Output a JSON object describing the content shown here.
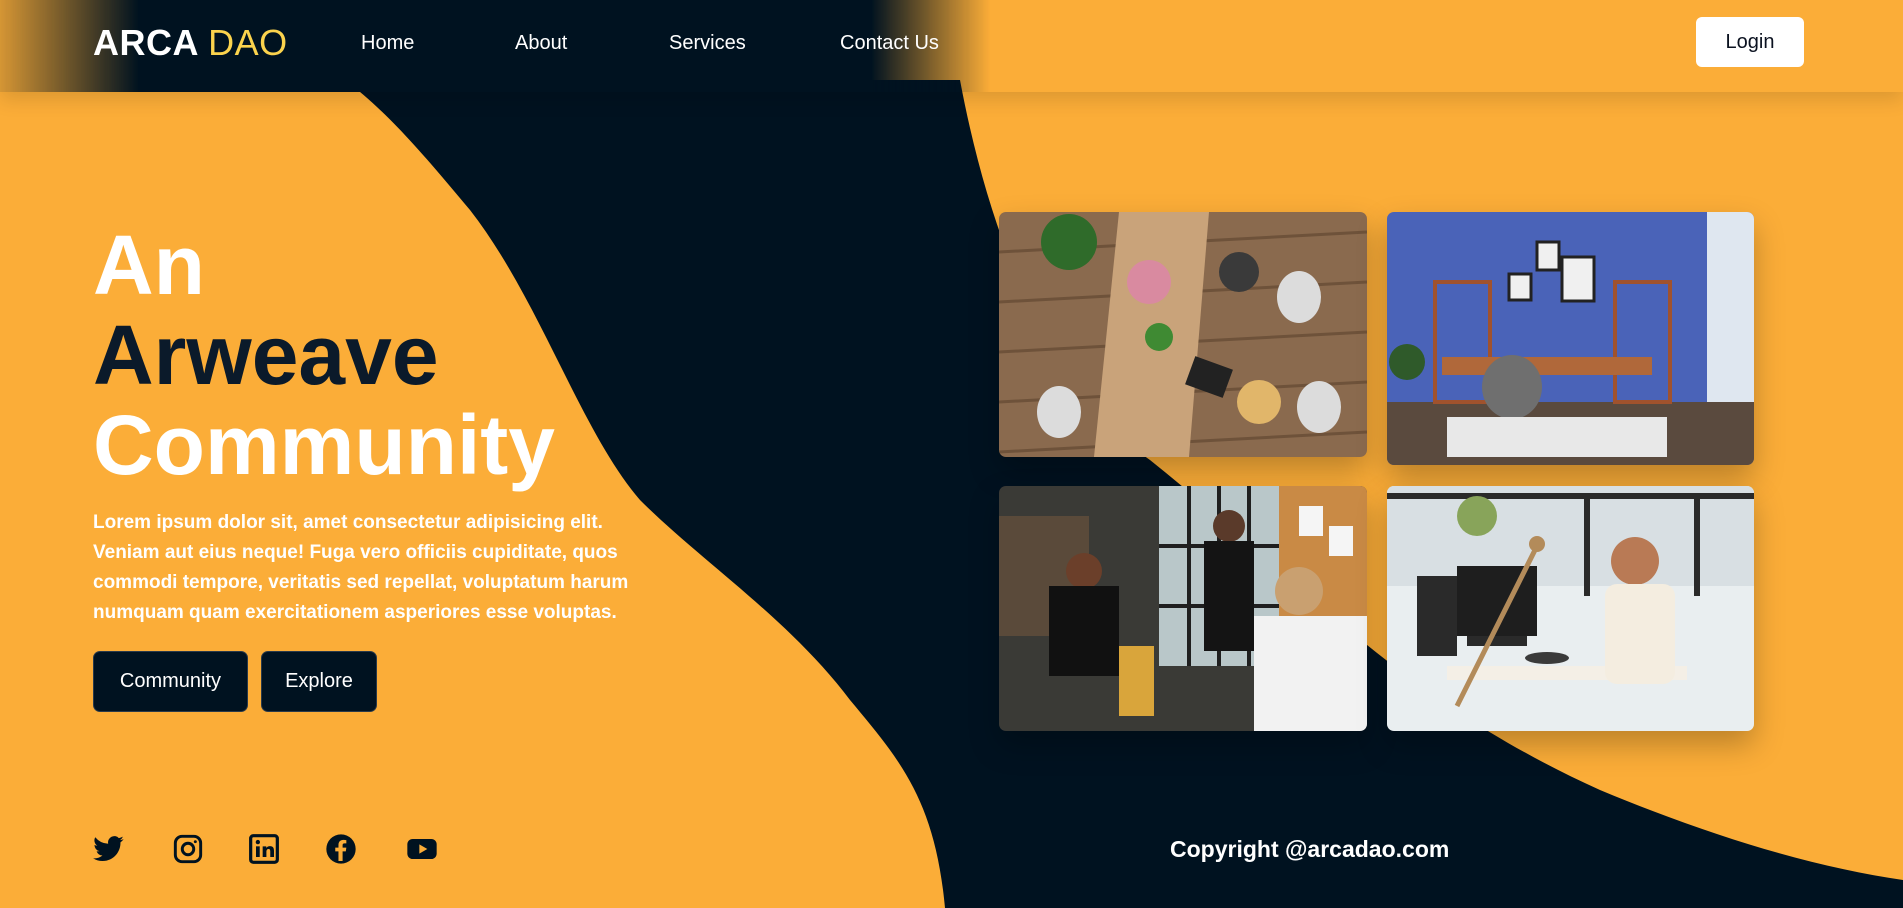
{
  "brand": {
    "name": "ARCA",
    "accent": "DAO"
  },
  "nav": {
    "links": [
      {
        "label": "Home"
      },
      {
        "label": "About"
      },
      {
        "label": "Services"
      },
      {
        "label": "Contact Us"
      }
    ],
    "login_label": "Login"
  },
  "hero": {
    "title_line1": "An",
    "title_line2": "Arweave",
    "title_line3": "Community",
    "description": "Lorem ipsum dolor sit, amet consectetur adipisicing elit. Veniam aut eius neque! Fuga vero officiis cupiditate, quos commodi tempore, veritatis sed repellat, voluptatum harum numquam quam exercitationem asperiores esse voluptas.",
    "buttons": [
      {
        "label": "Community"
      },
      {
        "label": "Explore"
      }
    ]
  },
  "gallery": [
    {
      "icon": "coworking-table-photo"
    },
    {
      "icon": "blue-office-photo"
    },
    {
      "icon": "office-meeting-photo"
    },
    {
      "icon": "man-at-computer-photo"
    }
  ],
  "social": [
    {
      "icon": "twitter-icon"
    },
    {
      "icon": "instagram-icon"
    },
    {
      "icon": "linkedin-icon"
    },
    {
      "icon": "facebook-icon"
    },
    {
      "icon": "youtube-icon"
    }
  ],
  "footer": {
    "copyright": "Copyright @arcadao.com"
  },
  "colors": {
    "orange": "#fbad38",
    "navy": "#001220",
    "accent_yellow": "#fbd34d",
    "white": "#ffffff"
  }
}
